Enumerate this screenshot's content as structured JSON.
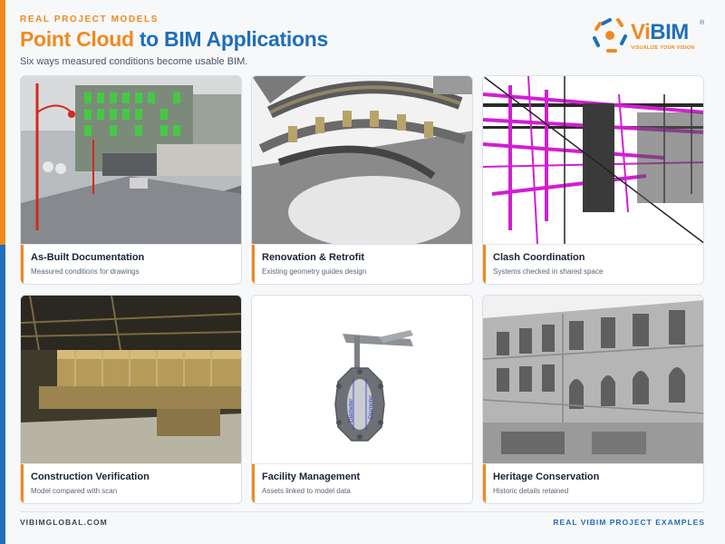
{
  "header": {
    "kicker": "REAL PROJECT MODELS",
    "title_accent": "Point Cloud",
    "title_rest": " to BIM Applications",
    "subtitle": "Six ways measured conditions become usable BIM."
  },
  "logo": {
    "brand_first": "Vi",
    "brand_second": "BIM",
    "registered": "®",
    "tagline": "VISUALIZE YOUR VISION"
  },
  "cards": [
    {
      "title": "As-Built Documentation",
      "subtitle": "Measured conditions for drawings"
    },
    {
      "title": "Renovation & Retrofit",
      "subtitle": "Existing geometry guides design"
    },
    {
      "title": "Clash Coordination",
      "subtitle": "Systems checked in shared space"
    },
    {
      "title": "Construction Verification",
      "subtitle": "Model compared with scan"
    },
    {
      "title": "Facility Management",
      "subtitle": "Assets linked to model data"
    },
    {
      "title": "Heritage Conservation",
      "subtitle": "Historic details retained"
    }
  ],
  "valve_labels": [
    "Diameter",
    "Diameter"
  ],
  "footer": {
    "left": "VIBIMGLOBAL.COM",
    "right": "REAL VIBIM PROJECT EXAMPLES"
  },
  "colors": {
    "accent_orange": "#ef8a1f",
    "brand_blue": "#1f6fb8",
    "pointcloud_green": "#3cd43c",
    "mep_magenta": "#d21ed2"
  },
  "icons": [
    "vibim-logo-icon"
  ]
}
